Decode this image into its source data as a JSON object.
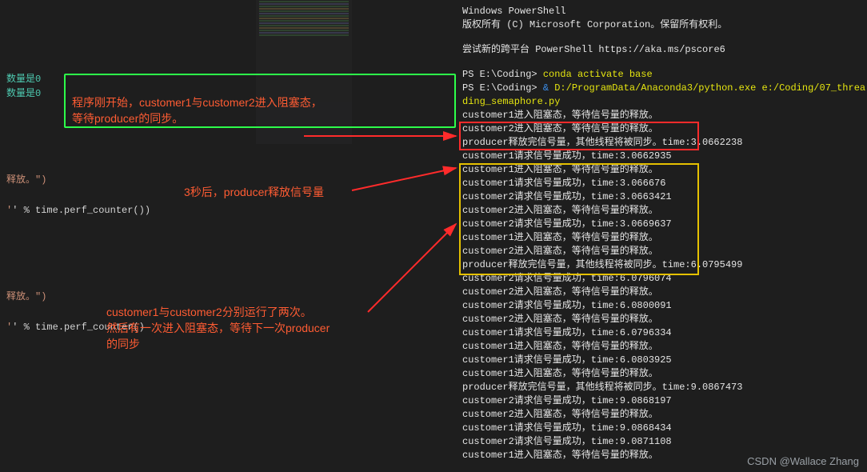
{
  "left": {
    "gutter1": "数量是0",
    "gutter2": "数量是0",
    "str1": "释放。\")",
    "expr1": "' % time.perf_counter())",
    "str2": "释放。\")",
    "expr2": "' % time.perf_counter()"
  },
  "annotations": {
    "a1": "程序刚开始，customer1与customer2进入阻塞态，\n等待producer的同步。",
    "a2": "3秒后，producer释放信号量",
    "a3": "customer1与customer2分别运行了两次。\n然后有一次进入阻塞态，等待下一次producer\n的同步"
  },
  "terminal": {
    "header1": "Windows PowerShell",
    "header2": "版权所有 (C) Microsoft Corporation。保留所有权利。",
    "header3": "尝试新的跨平台 PowerShell https://aka.ms/pscore6",
    "prompt1_pre": "PS E:\\Coding> ",
    "prompt1_cmd": "conda activate base",
    "prompt2_pre": "PS E:\\Coding> ",
    "prompt2_amp": "& ",
    "prompt2_cmd": "D:/ProgramData/Anaconda3/python.exe e:/Coding/07_threading_semaphore.py",
    "lines": [
      "customer1进入阻塞态，等待信号量的释放。",
      "customer2进入阻塞态，等待信号量的释放。",
      "producer释放完信号量，其他线程将被同步。time:3.0662238",
      "customer1请求信号量成功，time:3.0662935",
      "customer1进入阻塞态，等待信号量的释放。",
      "customer1请求信号量成功，time:3.066676",
      "customer2请求信号量成功，time:3.0663421",
      "customer2进入阻塞态，等待信号量的释放。",
      "customer2请求信号量成功，time:3.0669637",
      "customer1进入阻塞态，等待信号量的释放。",
      "customer2进入阻塞态，等待信号量的释放。",
      "producer释放完信号量，其他线程将被同步。time:6.0795499",
      "customer2请求信号量成功，time:6.0796074",
      "customer2进入阻塞态，等待信号量的释放。",
      "customer2请求信号量成功，time:6.0800091",
      "customer2进入阻塞态，等待信号量的释放。",
      "customer1请求信号量成功，time:6.0796334",
      "customer1进入阻塞态，等待信号量的释放。",
      "customer1请求信号量成功，time:6.0803925",
      "customer1进入阻塞态，等待信号量的释放。",
      "producer释放完信号量，其他线程将被同步。time:9.0867473",
      "customer2请求信号量成功，time:9.0868197",
      "customer2进入阻塞态，等待信号量的释放。",
      "customer1请求信号量成功，time:9.0868434",
      "customer2请求信号量成功，time:9.0871108",
      "customer1进入阻塞态，等待信号量的释放。"
    ]
  },
  "watermark": "CSDN @Wallace Zhang"
}
